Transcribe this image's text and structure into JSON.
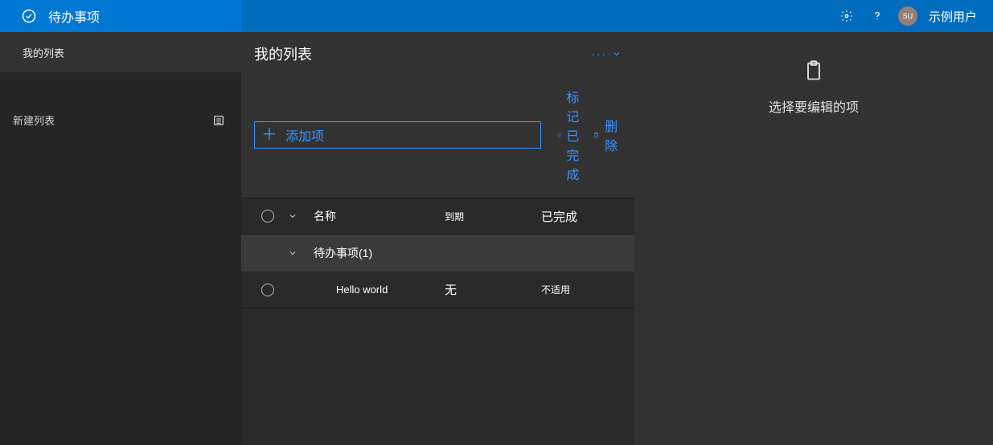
{
  "header": {
    "app_title": "待办事项",
    "username": "示例用户",
    "avatar_initials": "SU"
  },
  "sidebar": {
    "items": [
      {
        "label": "我的列表"
      }
    ],
    "new_list_placeholder": "新建列表"
  },
  "main": {
    "list_title": "我的列表",
    "add_item_label": "添加项",
    "mark_complete_label": "标记已完成",
    "delete_label": "删除",
    "columns": {
      "name": "名称",
      "due": "到期",
      "done": "已完成"
    },
    "group_label": "待办事项(1)",
    "rows": [
      {
        "name": "Hello world",
        "due": "无",
        "done": "不适用"
      }
    ]
  },
  "right_panel": {
    "empty_message": "选择要编辑的项"
  }
}
